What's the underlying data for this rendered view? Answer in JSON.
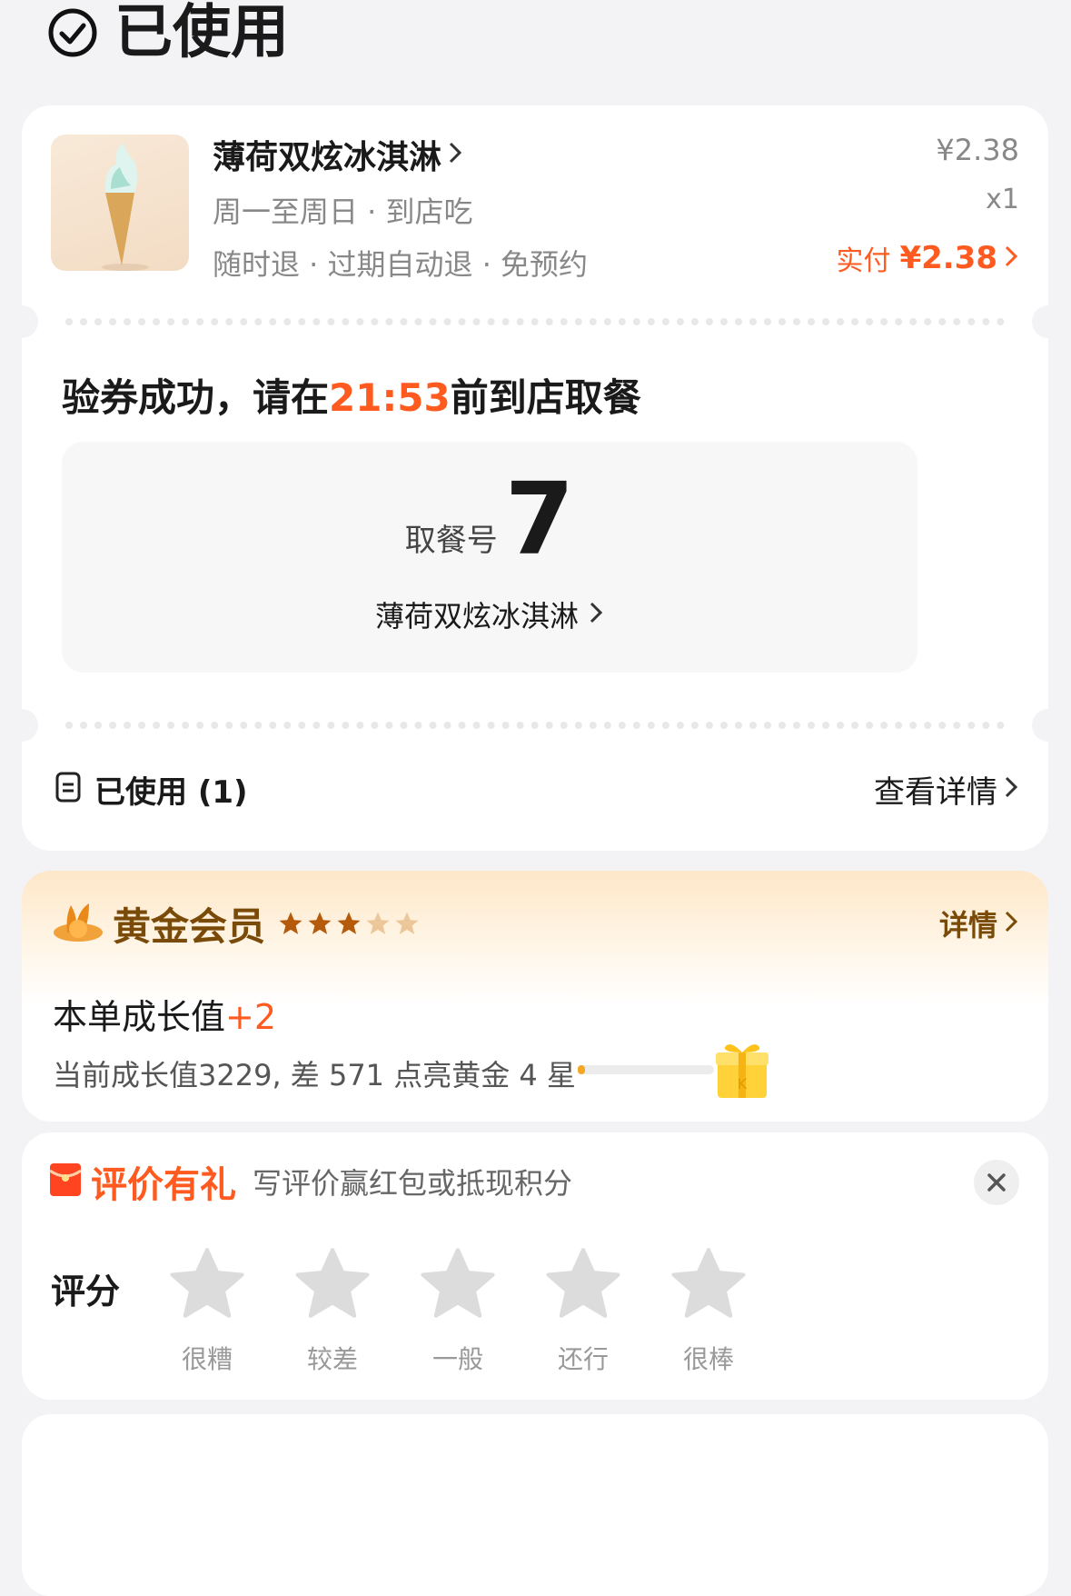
{
  "status": {
    "title": "已使用"
  },
  "order": {
    "product_name": "薄荷双炫冰淇淋",
    "tag_line1": "周一至周日 · 到店吃",
    "tag_line2": "随时退 · 过期自动退 · 免预约",
    "price": "¥2.38",
    "quantity": "x1",
    "paid_label": "实付",
    "paid_amount": "¥2.38",
    "verify_prefix": "验券成功，请在",
    "verify_time": "21:53",
    "verify_suffix": "前到店取餐",
    "pickup_label": "取餐号",
    "pickup_number": "7",
    "pickup_item": "薄荷双炫冰淇淋",
    "used_label": "已使用 (1)",
    "details_label": "查看详情"
  },
  "member": {
    "level": "黄金会员",
    "stars_filled": 3,
    "stars_total": 5,
    "details_label": "详情",
    "growth_prefix": "本单成长值",
    "growth_value": "+2",
    "progress_text": "当前成长值3229, 差 571 点亮黄金 4 星",
    "progress_fraction": 0.05
  },
  "review": {
    "title": "评价有礼",
    "subtitle": "写评价赢红包或抵现积分",
    "rating_label": "评分",
    "options": [
      "很糟",
      "较差",
      "一般",
      "还行",
      "很棒"
    ]
  },
  "colors": {
    "accent": "#ff5a1f",
    "gold_text": "#7a4a08",
    "gold_star": "#b45a0a"
  }
}
